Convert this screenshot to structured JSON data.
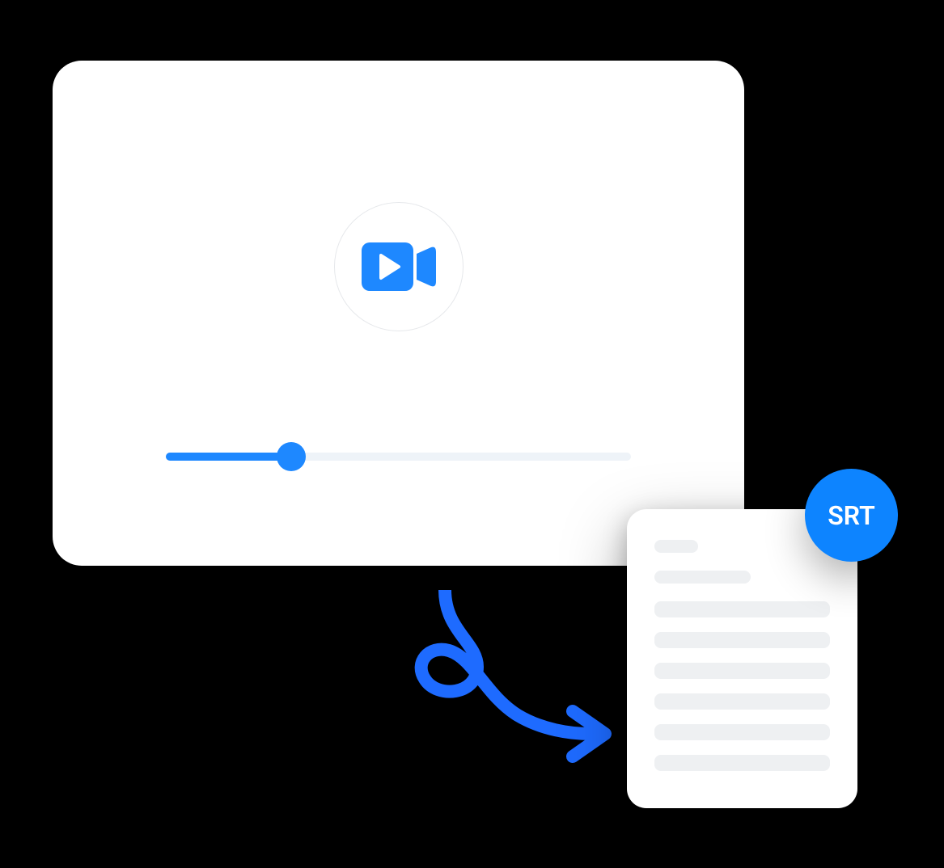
{
  "colors": {
    "accent": "#1e88ff",
    "badge": "#0d84ff",
    "track": "#eef3f8",
    "docline": "#eef0f2"
  },
  "video": {
    "progress_percent": 27
  },
  "badge": {
    "label": "SRT"
  },
  "doc": {
    "line_widths": [
      "short",
      "med",
      "long",
      "long",
      "long",
      "long",
      "long",
      "long"
    ]
  }
}
